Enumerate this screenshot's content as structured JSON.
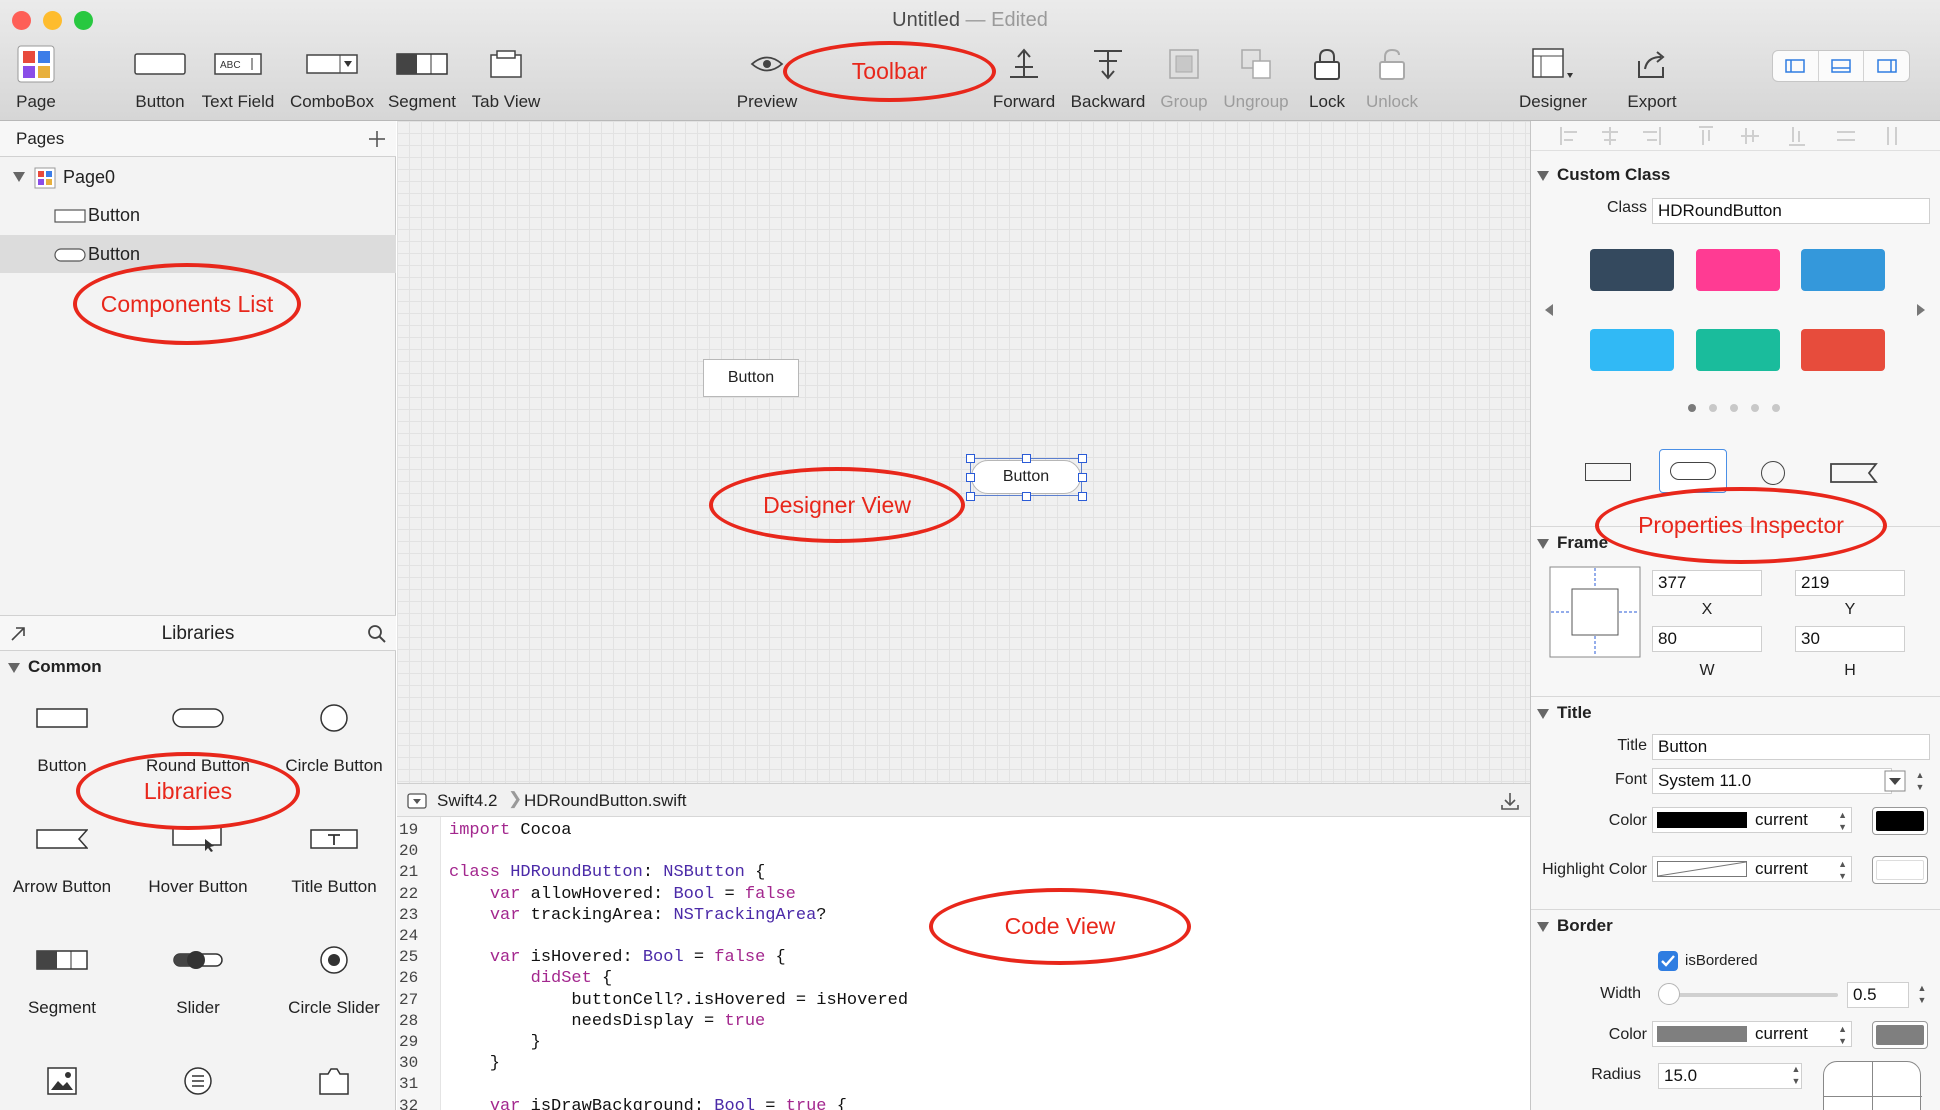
{
  "window": {
    "title": "Untitled",
    "edited_suffix": "— Edited",
    "traffic_colors": [
      "#fe5f57",
      "#febc2e",
      "#28c840"
    ]
  },
  "toolbar": {
    "page": "Page",
    "button": "Button",
    "text_field": "Text Field",
    "combobox": "ComboBox",
    "segment": "Segment",
    "tab_view": "Tab View",
    "preview": "Preview",
    "forward": "Forward",
    "backward": "Backward",
    "group": "Group",
    "ungroup": "Ungroup",
    "lock": "Lock",
    "unlock": "Unlock",
    "designer": "Designer",
    "export": "Export",
    "text_field_icon": "ABC"
  },
  "pages_panel": {
    "title": "Pages",
    "page_name": "Page0",
    "items": [
      "Button",
      "Button"
    ]
  },
  "libraries": {
    "title": "Libraries",
    "section": "Common",
    "items": [
      "Button",
      "Round Button",
      "Circle Button",
      "Arrow Button",
      "Hover Button",
      "Title Button",
      "Segment",
      "Slider",
      "Circle Slider"
    ]
  },
  "designer": {
    "button1_label": "Button",
    "button2_label": "Button"
  },
  "code_view": {
    "language": "Swift4.2",
    "filename": "HDRoundButton.swift",
    "line_numbers": [
      "19",
      "20",
      "21",
      "22",
      "23",
      "24",
      "25",
      "26",
      "27",
      "28",
      "29",
      "30",
      "31",
      "32"
    ],
    "lines": [
      [
        {
          "k": "import",
          "t": "kw"
        },
        {
          "k": " Cocoa",
          "t": "n"
        }
      ],
      [],
      [
        {
          "k": "class",
          "t": "kw"
        },
        {
          "k": " ",
          "t": "n"
        },
        {
          "k": "HDRoundButton",
          "t": "ty"
        },
        {
          "k": ": ",
          "t": "n"
        },
        {
          "k": "NSButton",
          "t": "ty"
        },
        {
          "k": " {",
          "t": "n"
        }
      ],
      [
        {
          "k": "    ",
          "t": "n"
        },
        {
          "k": "var",
          "t": "kw"
        },
        {
          "k": " allowHovered: ",
          "t": "n"
        },
        {
          "k": "Bool",
          "t": "ty"
        },
        {
          "k": " = ",
          "t": "n"
        },
        {
          "k": "false",
          "t": "kw"
        }
      ],
      [
        {
          "k": "    ",
          "t": "n"
        },
        {
          "k": "var",
          "t": "kw"
        },
        {
          "k": " trackingArea: ",
          "t": "n"
        },
        {
          "k": "NSTrackingArea",
          "t": "ty"
        },
        {
          "k": "?",
          "t": "n"
        }
      ],
      [],
      [
        {
          "k": "    ",
          "t": "n"
        },
        {
          "k": "var",
          "t": "kw"
        },
        {
          "k": " isHovered: ",
          "t": "n"
        },
        {
          "k": "Bool",
          "t": "ty"
        },
        {
          "k": " = ",
          "t": "n"
        },
        {
          "k": "false",
          "t": "kw"
        },
        {
          "k": " {",
          "t": "n"
        }
      ],
      [
        {
          "k": "        ",
          "t": "n"
        },
        {
          "k": "didSet",
          "t": "kw"
        },
        {
          "k": " {",
          "t": "n"
        }
      ],
      [
        {
          "k": "            buttonCell?.isHovered = isHovered",
          "t": "n"
        }
      ],
      [
        {
          "k": "            needsDisplay = ",
          "t": "n"
        },
        {
          "k": "true",
          "t": "kw"
        }
      ],
      [
        {
          "k": "        }",
          "t": "n"
        }
      ],
      [
        {
          "k": "    }",
          "t": "n"
        }
      ],
      [],
      [
        {
          "k": "    ",
          "t": "n"
        },
        {
          "k": "var",
          "t": "kw"
        },
        {
          "k": " isDrawBackground: ",
          "t": "n"
        },
        {
          "k": "Bool",
          "t": "ty"
        },
        {
          "k": " = ",
          "t": "n"
        },
        {
          "k": "true",
          "t": "kw"
        },
        {
          "k": " {",
          "t": "n"
        }
      ]
    ]
  },
  "inspector": {
    "custom_class": {
      "heading": "Custom Class",
      "class_label": "Class",
      "class_value": "HDRoundButton"
    },
    "style_swatches": [
      "#34495e",
      "#ff3b93",
      "#3498db",
      "#31b9f5",
      "#1abc9c",
      "#e74c3c"
    ],
    "frame": {
      "heading": "Frame",
      "x": "377",
      "y": "219",
      "w": "80",
      "h": "30",
      "x_label": "X",
      "y_label": "Y",
      "w_label": "W",
      "h_label": "H"
    },
    "title": {
      "heading": "Title",
      "title_label": "Title",
      "title_value": "Button",
      "font_label": "Font",
      "font_value": "System  11.0",
      "color_label": "Color",
      "color_value": "current",
      "highlight_label": "Highlight Color",
      "highlight_value": "current"
    },
    "border": {
      "heading": "Border",
      "bordered_label": "isBordered",
      "bordered_checked": true,
      "width_label": "Width",
      "width_value": "0.5",
      "color_label": "Color",
      "color_value": "current",
      "radius_label": "Radius",
      "radius_value": "15.0",
      "border_color": "#7f7f7f"
    }
  },
  "annotations": {
    "toolbar": "Toolbar",
    "components_list": "Components List",
    "libraries": "Libraries",
    "designer_view": "Designer View",
    "code_view": "Code View",
    "properties_inspector": "Properties Inspector",
    "color": "#e8271b"
  }
}
